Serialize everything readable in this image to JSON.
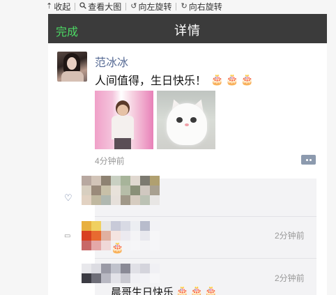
{
  "viewer_toolbar": {
    "items": [
      {
        "icon": "upload-icon",
        "glyph": "⇡",
        "label": "收起"
      },
      {
        "icon": "magnifier-icon",
        "glyph": "🔍",
        "label": "查看大图"
      },
      {
        "icon": "rotate-left-icon",
        "glyph": "↺",
        "label": "向左旋转"
      },
      {
        "icon": "rotate-right-icon",
        "glyph": "↻",
        "label": "向右旋转"
      }
    ]
  },
  "navbar": {
    "done_label": "完成",
    "title": "详情",
    "background": "#3b3b3b",
    "done_color": "#4cd964"
  },
  "post": {
    "author": "范冰冰",
    "text": "人间值得，生日快乐！",
    "emoji": "🎂",
    "emoji_count": 3,
    "time": "4分钟前",
    "link_color": "#576b95"
  },
  "comments": [
    {
      "time": "2分钟前",
      "reply_emoji": "🎂"
    },
    {
      "time": "2分钟前",
      "text": "晨哥生日快乐",
      "emoji": "🎂",
      "emoji_count": 3
    }
  ]
}
